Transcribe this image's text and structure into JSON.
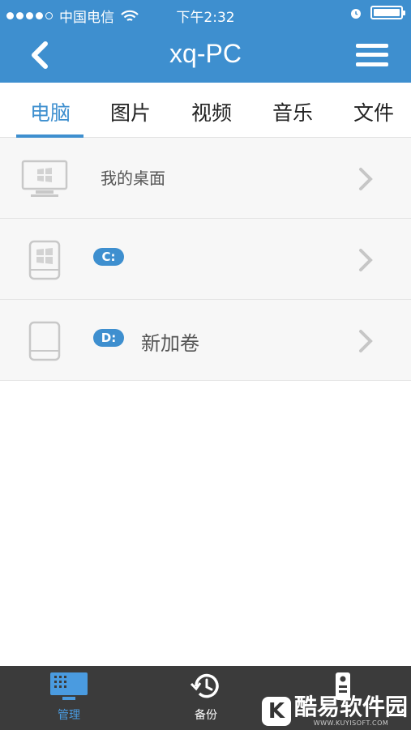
{
  "status_bar": {
    "carrier": "中国电信",
    "time": "下午2:32"
  },
  "nav_bar": {
    "title": "xq-PC"
  },
  "tabs": [
    {
      "label": "电脑",
      "active": true
    },
    {
      "label": "图片",
      "active": false
    },
    {
      "label": "视频",
      "active": false
    },
    {
      "label": "音乐",
      "active": false
    },
    {
      "label": "文件",
      "active": false
    }
  ],
  "list": [
    {
      "icon": "desktop-monitor-icon",
      "label": "我的桌面"
    },
    {
      "icon": "windows-drive-icon",
      "badge": "C:",
      "label": ""
    },
    {
      "icon": "hard-drive-icon",
      "badge": "D:",
      "label": "新加卷"
    }
  ],
  "tab_bar": {
    "items": [
      {
        "label": "管理",
        "icon": "screen-grid-icon",
        "active": true
      },
      {
        "label": "备份",
        "icon": "history-clock-icon",
        "active": false
      },
      {
        "label": "",
        "icon": "remote-control-icon",
        "active": false
      }
    ]
  },
  "watermark": {
    "logo": "K",
    "text": "酷易软件园",
    "sub": "WWW.KUYISOFT.COM"
  },
  "colors": {
    "accent": "#3e8fcf",
    "tab_bar_bg": "#3b3b3b"
  }
}
